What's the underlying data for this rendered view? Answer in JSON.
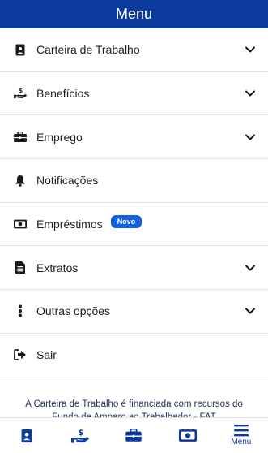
{
  "header": {
    "title": "Menu"
  },
  "menu": {
    "items": [
      {
        "label": "Carteira de Trabalho",
        "icon": "work-card-icon",
        "expandable": true
      },
      {
        "label": "Benefícios",
        "icon": "hand-money-icon",
        "expandable": true
      },
      {
        "label": "Emprego",
        "icon": "briefcase-icon",
        "expandable": true
      },
      {
        "label": "Notificações",
        "icon": "bell-icon",
        "expandable": false
      },
      {
        "label": "Empréstimos",
        "icon": "banknote-icon",
        "expandable": false,
        "badge": "Novo"
      },
      {
        "label": "Extratos",
        "icon": "document-icon",
        "expandable": true
      },
      {
        "label": "Outras opções",
        "icon": "vertical-dots-icon",
        "expandable": true
      },
      {
        "label": "Sair",
        "icon": "logout-icon",
        "expandable": false
      }
    ]
  },
  "footer": {
    "note": "A Carteira de Trabalho é financiada com recursos do Fundo de Amparo ao Trabalhador - FAT"
  },
  "bottom_nav": {
    "items": [
      {
        "icon": "work-card-icon"
      },
      {
        "icon": "hand-money-icon"
      },
      {
        "icon": "briefcase-icon"
      },
      {
        "icon": "banknote-icon"
      },
      {
        "icon": "hamburger-menu-icon",
        "label": "Menu"
      }
    ]
  },
  "colors": {
    "header_bg": "#0a3b9c",
    "accent": "#0a3b9c",
    "badge_bg": "#1461e0"
  }
}
